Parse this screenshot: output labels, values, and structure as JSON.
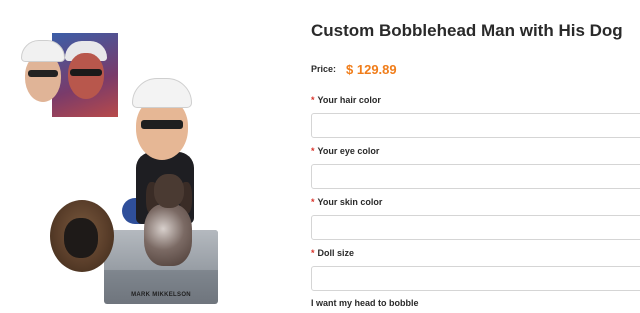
{
  "product": {
    "title": "Custom Bobblehead Man with His Dog",
    "price_label": "Price:",
    "price_value": "$ 129.89",
    "plaque_text": "MARK MIKKELSON"
  },
  "options": [
    {
      "required_mark": "*",
      "label": "Your hair color",
      "value": ""
    },
    {
      "required_mark": "*",
      "label": "Your eye color",
      "value": ""
    },
    {
      "required_mark": "*",
      "label": "Your skin color",
      "value": ""
    },
    {
      "required_mark": "*",
      "label": "Doll size",
      "value": ""
    }
  ],
  "bobble_label": "I want my head to bobble",
  "colors": {
    "price": "#f07d1a",
    "required": "#d9342b",
    "text": "#2a2a2a",
    "field_border": "#d5d5d5"
  }
}
